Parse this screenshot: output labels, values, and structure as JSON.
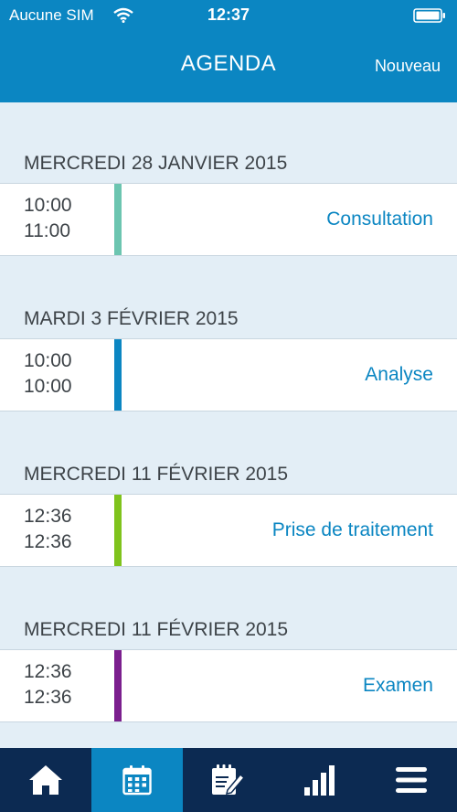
{
  "status_bar": {
    "carrier": "Aucune SIM",
    "time": "12:37",
    "icons": [
      "wifi-icon",
      "battery-icon"
    ]
  },
  "header": {
    "title": "AGENDA",
    "new_button": "Nouveau"
  },
  "events": [
    {
      "date": "MERCREDI 28 JANVIER 2015",
      "start": "10:00",
      "end": "11:00",
      "title": "Consultation",
      "color": "#6cc5b0"
    },
    {
      "date": "MARDI 3 FÉVRIER 2015",
      "start": "10:00",
      "end": "10:00",
      "title": "Analyse",
      "color": "#0b86c2"
    },
    {
      "date": "MERCREDI 11 FÉVRIER 2015",
      "start": "12:36",
      "end": "12:36",
      "title": "Prise de traitement",
      "color": "#7fc31c"
    },
    {
      "date": "MERCREDI 11 FÉVRIER 2015",
      "start": "12:36",
      "end": "12:36",
      "title": "Examen",
      "color": "#7b1f8e"
    }
  ],
  "tab_bar": {
    "tabs": [
      {
        "icon": "home-icon",
        "active": false
      },
      {
        "icon": "calendar-icon",
        "active": true
      },
      {
        "icon": "notepad-edit-icon",
        "active": false
      },
      {
        "icon": "bar-chart-icon",
        "active": false
      },
      {
        "icon": "menu-icon",
        "active": false
      }
    ],
    "colors": {
      "background": "#0c2a52",
      "active": "#0b86c2"
    }
  },
  "colors": {
    "accent": "#0b86c2",
    "page_background": "#e3eef6",
    "text": "#3d4348"
  }
}
